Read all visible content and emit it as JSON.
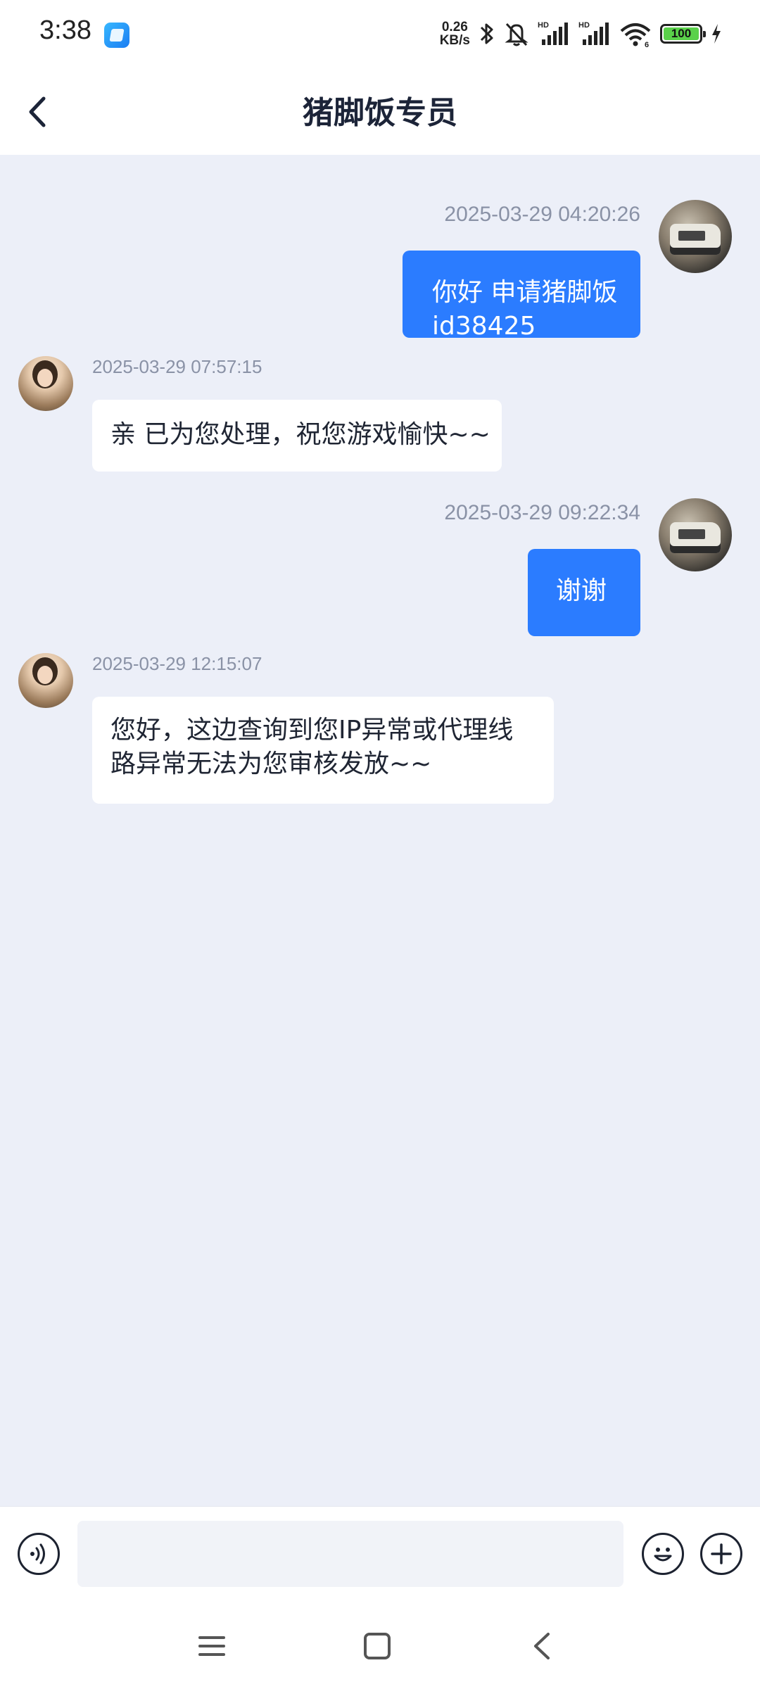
{
  "status_bar": {
    "time": "3:38",
    "net_speed_value": "0.26",
    "net_speed_unit": "KB/s",
    "battery": "100"
  },
  "header": {
    "title": "猪脚饭专员"
  },
  "messages": [
    {
      "direction": "outgoing",
      "time": "2025-03-29 04:20:26",
      "text": "你好 申请猪脚饭 id38425"
    },
    {
      "direction": "incoming",
      "time": "2025-03-29 07:57:15",
      "text": "亲 已为您处理，祝您游戏愉快~~"
    },
    {
      "direction": "outgoing",
      "time": "2025-03-29 09:22:34",
      "text": "谢谢"
    },
    {
      "direction": "incoming",
      "time": "2025-03-29 12:15:07",
      "text_lines": [
        "您好，这边查询到您IP异常或代理线",
        "路异常无法为您审核发放~~"
      ]
    }
  ],
  "input_bar": {
    "value": "",
    "voice_icon": "voice-icon",
    "emoji_icon": "emoji-icon",
    "plus_icon": "plus-icon"
  },
  "colors": {
    "outgoing_bubble": "#2b7cff",
    "incoming_bubble": "#ffffff",
    "chat_background": "#eceff8",
    "timestamp": "#8a92a6"
  }
}
